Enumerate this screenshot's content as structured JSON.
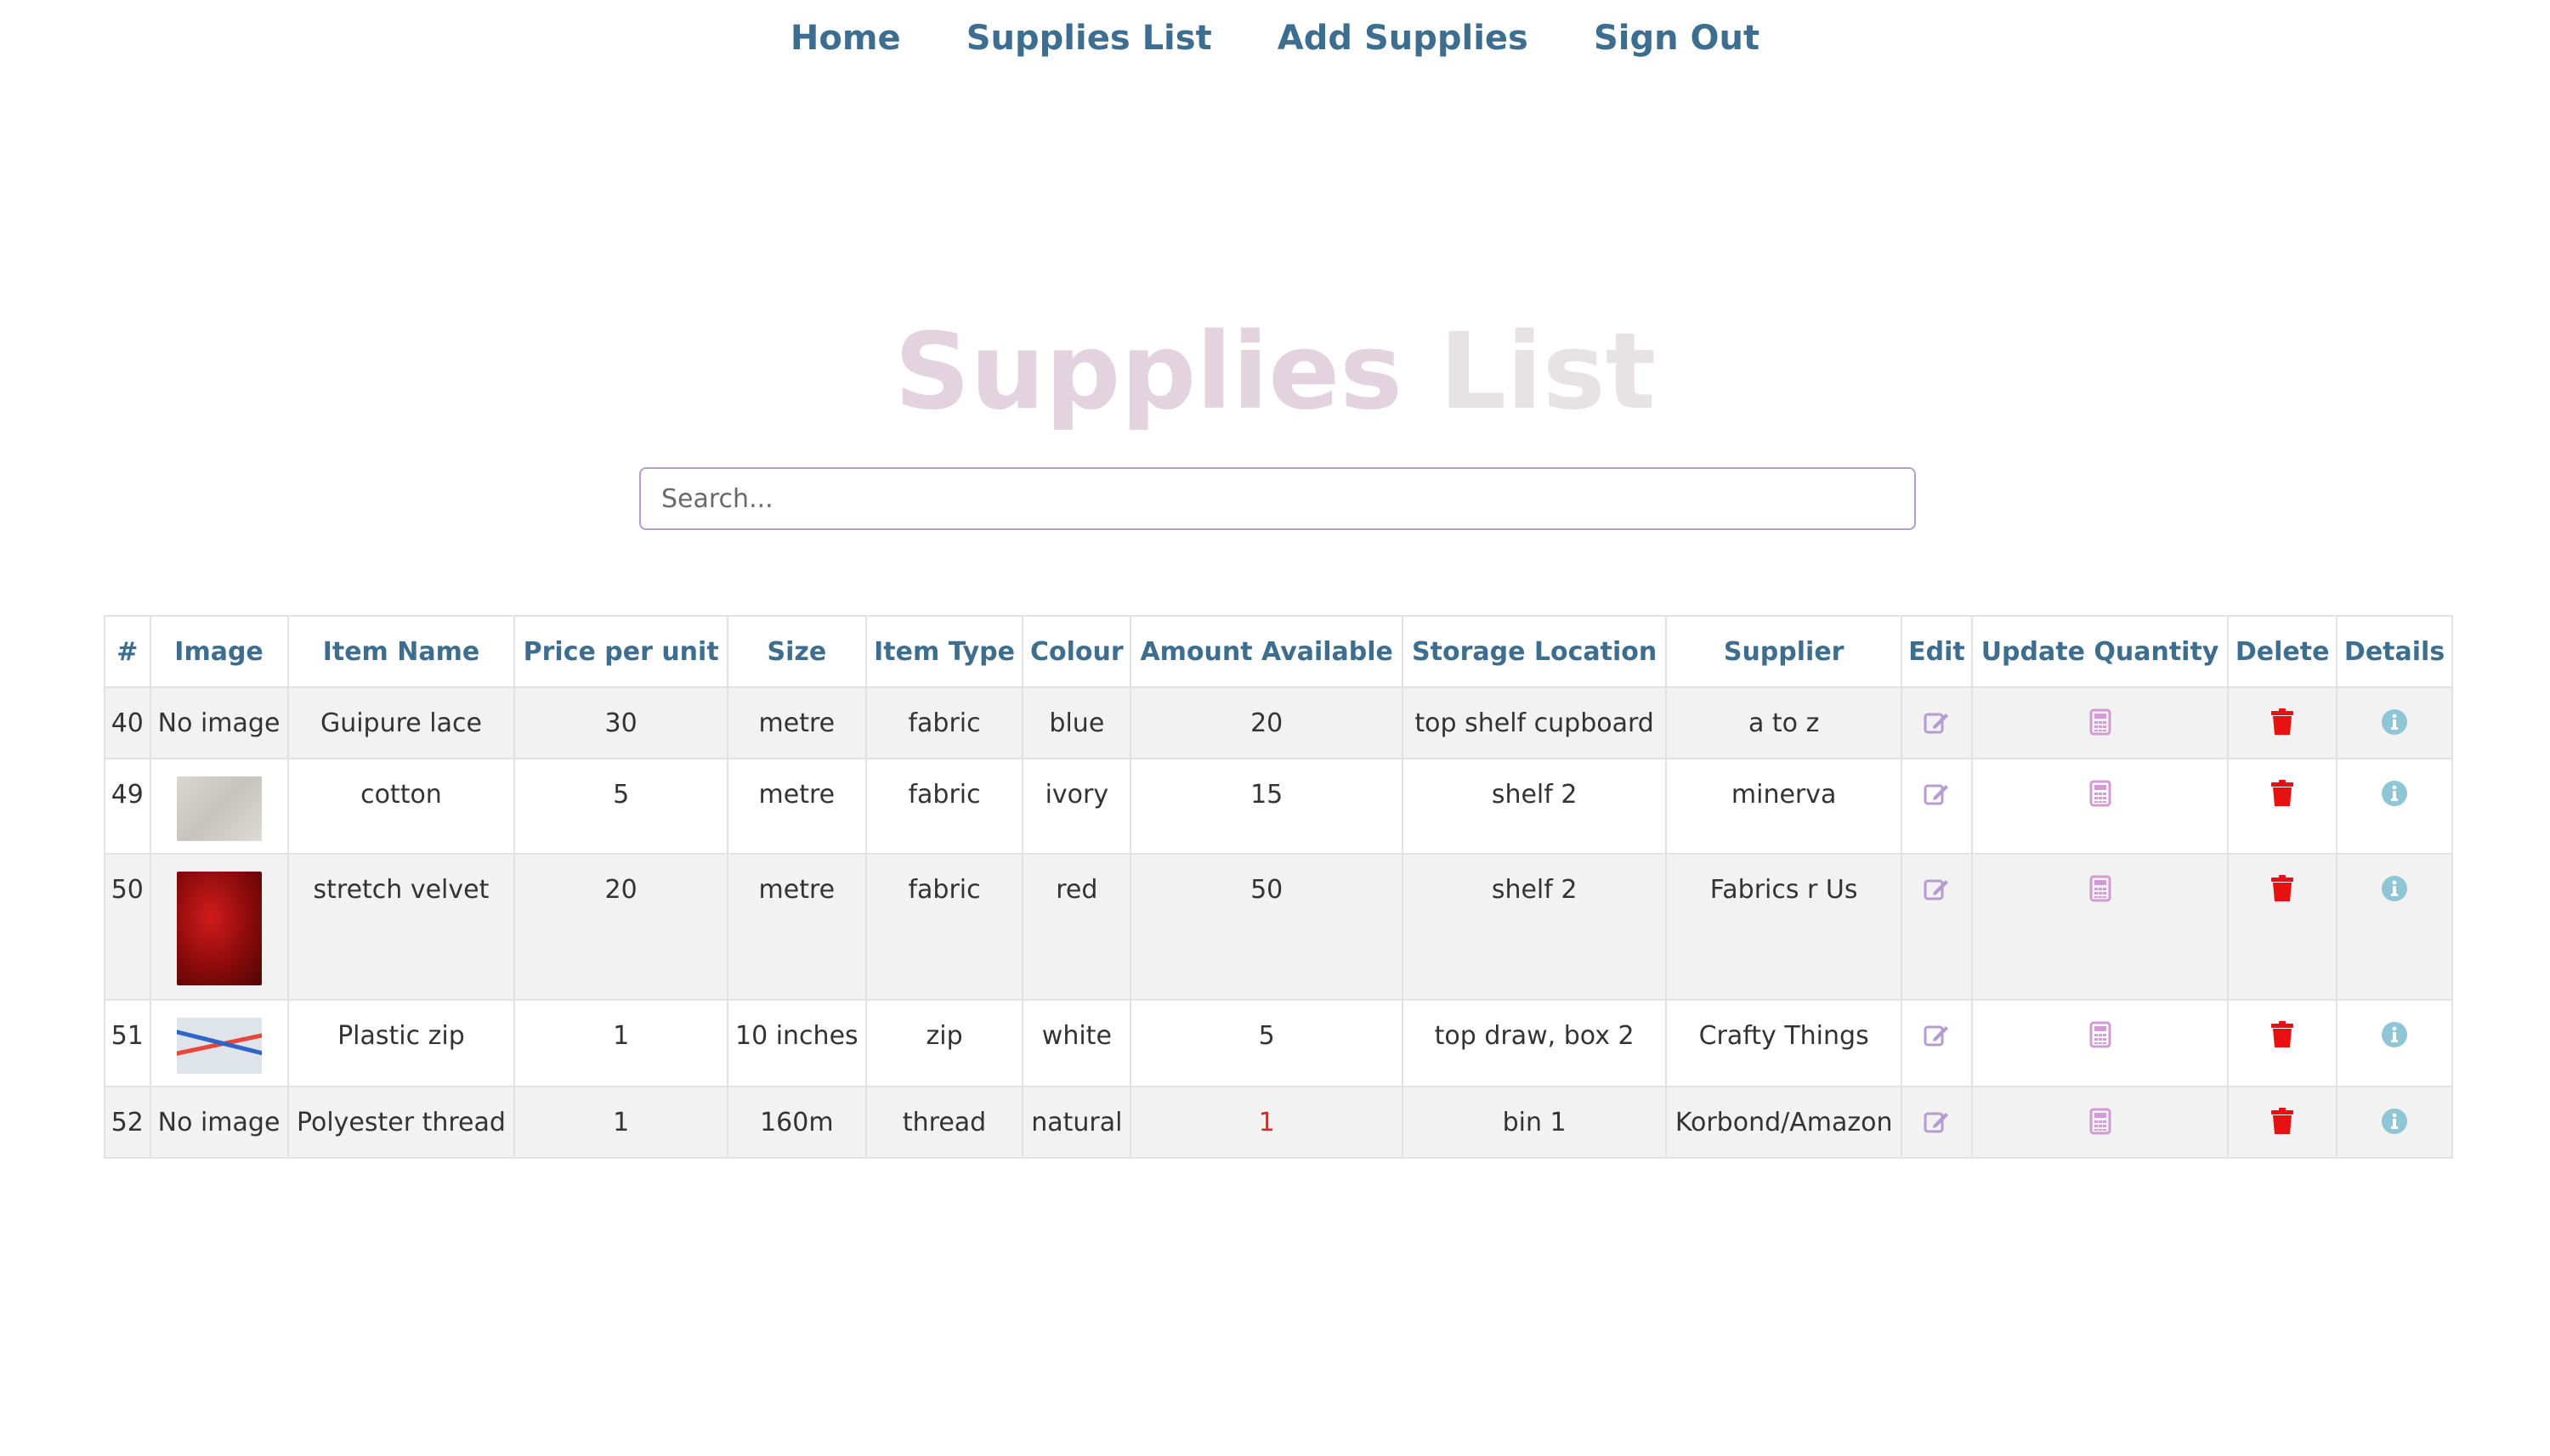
{
  "nav": {
    "home": "Home",
    "supplies_list": "Supplies List",
    "add_supplies": "Add Supplies",
    "sign_out": "Sign Out"
  },
  "page": {
    "title_word1": "Supplies",
    "title_word2": "List"
  },
  "search": {
    "placeholder": "Search...",
    "value": ""
  },
  "table": {
    "headers": {
      "num": "#",
      "image": "Image",
      "item_name": "Item Name",
      "price": "Price per unit",
      "size": "Size",
      "item_type": "Item Type",
      "colour": "Colour",
      "amount": "Amount Available",
      "storage": "Storage Location",
      "supplier": "Supplier",
      "edit": "Edit",
      "update_qty": "Update Quantity",
      "delete": "Delete",
      "details": "Details"
    },
    "rows": [
      {
        "id": "40",
        "image": "No image",
        "name": "Guipure lace",
        "price": "30",
        "size": "metre",
        "type": "fabric",
        "colour": "blue",
        "amount": "20",
        "storage": "top shelf cupboard",
        "supplier": "a to z"
      },
      {
        "id": "49",
        "image": "",
        "name": "cotton",
        "price": "5",
        "size": "metre",
        "type": "fabric",
        "colour": "ivory",
        "amount": "15",
        "storage": "shelf 2",
        "supplier": "minerva"
      },
      {
        "id": "50",
        "image": "",
        "name": "stretch velvet",
        "price": "20",
        "size": "metre",
        "type": "fabric",
        "colour": "red",
        "amount": "50",
        "storage": "shelf 2",
        "supplier": "Fabrics r Us"
      },
      {
        "id": "51",
        "image": "",
        "name": "Plastic zip",
        "price": "1",
        "size": "10 inches",
        "type": "zip",
        "colour": "white",
        "amount": "5",
        "storage": "top draw, box 2",
        "supplier": "Crafty Things"
      },
      {
        "id": "52",
        "image": "No image",
        "name": "Polyester thread",
        "price": "1",
        "size": "160m",
        "type": "thread",
        "colour": "natural",
        "amount": "1",
        "storage": "bin 1",
        "supplier": "Korbond/Amazon"
      }
    ]
  },
  "icons": {
    "edit": "edit-icon",
    "update_quantity": "calculator-icon",
    "delete": "trash-icon",
    "details": "info-icon"
  },
  "colors": {
    "nav_link": "#3d6e8f",
    "header_text": "#3d6e8f",
    "low_stock": "#e02525",
    "delete_icon": "#e81010",
    "edit_icon": "#b59cd0",
    "calculator_icon": "#d39ad3",
    "info_icon": "#8ec6d6",
    "search_border": "#b59cd0"
  }
}
